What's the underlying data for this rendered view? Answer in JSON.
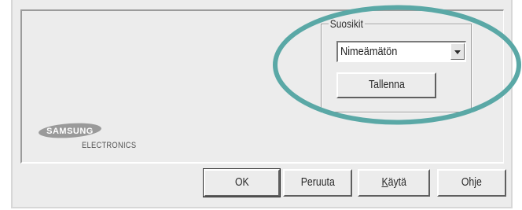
{
  "favorites": {
    "group_label": "Suosikit",
    "selected_value": "Nimeämätön",
    "save_label": "Tallenna"
  },
  "brand": {
    "logo_text": "SAMSUNG",
    "sub_text": "ELECTRONICS"
  },
  "footer": {
    "ok_label": "OK",
    "cancel_label": "Peruuta",
    "apply_label_prefix": "K",
    "apply_label_rest": "äytä",
    "help_label": "Ohje"
  },
  "colors": {
    "highlight": "#5aa8a6",
    "dialog_bg": "#ececec"
  },
  "icons": {
    "dropdown": "chevron-down-icon"
  }
}
